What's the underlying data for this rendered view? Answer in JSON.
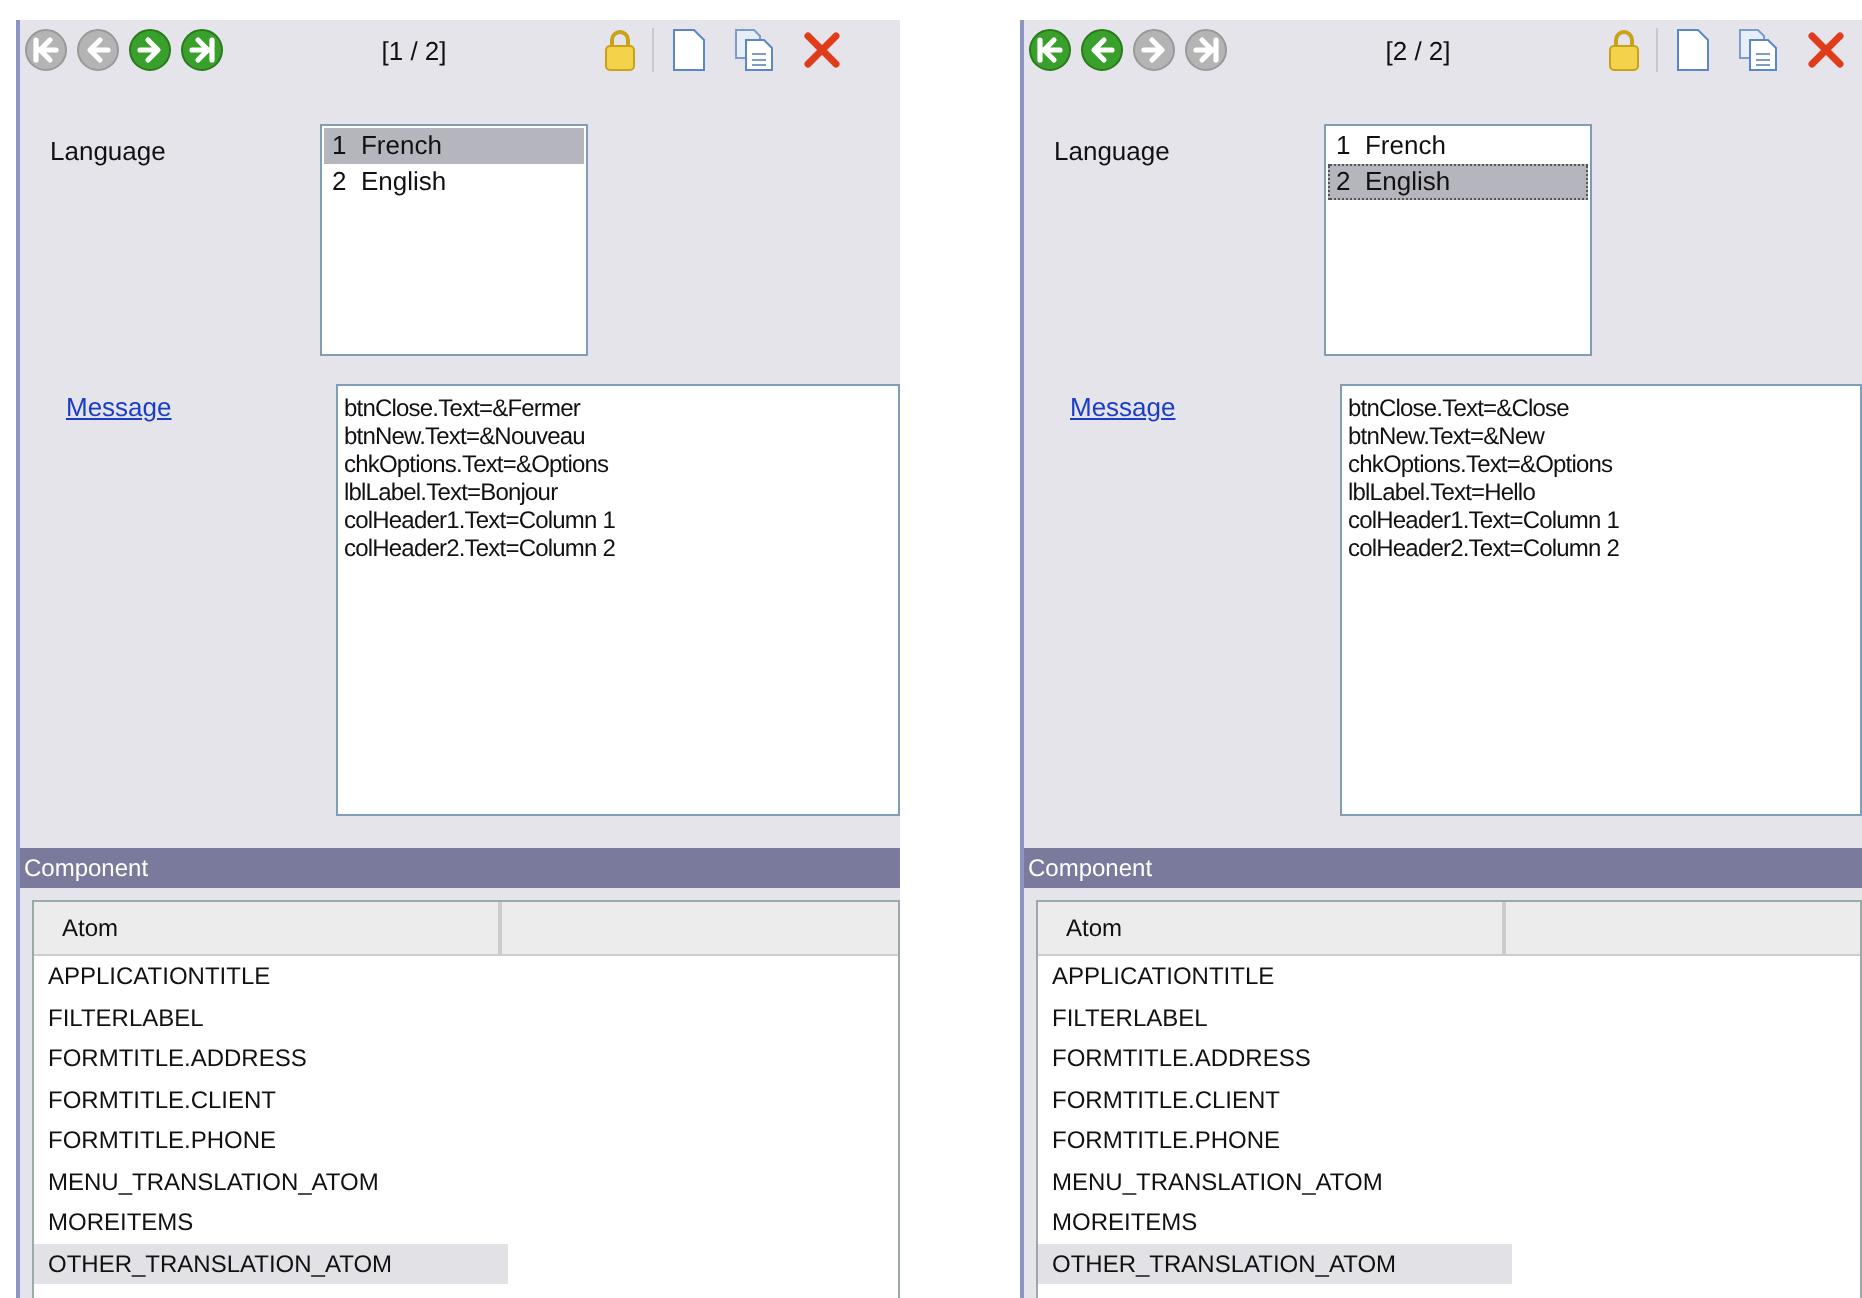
{
  "panels": [
    {
      "nav_buttons": [
        {
          "kind": "first",
          "disabled": true
        },
        {
          "kind": "previous",
          "disabled": true
        },
        {
          "kind": "next",
          "disabled": false
        },
        {
          "kind": "last",
          "disabled": false
        }
      ],
      "record_counter": "[1 / 2]",
      "language": {
        "label": "Language",
        "items": [
          {
            "number": "1",
            "name": "French",
            "selected": true
          },
          {
            "number": "2",
            "name": "English",
            "selected": false
          }
        ]
      },
      "message": {
        "label": "Message",
        "lines": [
          "btnClose.Text=&Fermer",
          "btnNew.Text=&Nouveau",
          "chkOptions.Text=&Options",
          "lblLabel.Text=Bonjour",
          "colHeader1.Text=Column 1",
          "colHeader2.Text=Column 2"
        ]
      },
      "component": {
        "title": "Component",
        "column": "Atom",
        "rows": [
          {
            "atom": "APPLICATIONTITLE",
            "selected": false
          },
          {
            "atom": "FILTERLABEL",
            "selected": false
          },
          {
            "atom": "FORMTITLE.ADDRESS",
            "selected": false
          },
          {
            "atom": "FORMTITLE.CLIENT",
            "selected": false
          },
          {
            "atom": "FORMTITLE.PHONE",
            "selected": false
          },
          {
            "atom": "MENU_TRANSLATION_ATOM",
            "selected": false
          },
          {
            "atom": "MOREITEMS",
            "selected": false
          },
          {
            "atom": "OTHER_TRANSLATION_ATOM",
            "selected": true
          }
        ]
      }
    },
    {
      "nav_buttons": [
        {
          "kind": "first",
          "disabled": false
        },
        {
          "kind": "previous",
          "disabled": false
        },
        {
          "kind": "next",
          "disabled": true
        },
        {
          "kind": "last",
          "disabled": true
        }
      ],
      "record_counter": "[2 / 2]",
      "language": {
        "label": "Language",
        "items": [
          {
            "number": "1",
            "name": "French",
            "selected": false
          },
          {
            "number": "2",
            "name": "English",
            "selected": true
          }
        ]
      },
      "message": {
        "label": "Message",
        "lines": [
          "btnClose.Text=&Close",
          "btnNew.Text=&New",
          "chkOptions.Text=&Options",
          "lblLabel.Text=Hello",
          "colHeader1.Text=Column 1",
          "colHeader2.Text=Column 2"
        ]
      },
      "component": {
        "title": "Component",
        "column": "Atom",
        "rows": [
          {
            "atom": "APPLICATIONTITLE",
            "selected": false
          },
          {
            "atom": "FILTERLABEL",
            "selected": false
          },
          {
            "atom": "FORMTITLE.ADDRESS",
            "selected": false
          },
          {
            "atom": "FORMTITLE.CLIENT",
            "selected": false
          },
          {
            "atom": "FORMTITLE.PHONE",
            "selected": false
          },
          {
            "atom": "MENU_TRANSLATION_ATOM",
            "selected": false
          },
          {
            "atom": "MOREITEMS",
            "selected": false
          },
          {
            "atom": "OTHER_TRANSLATION_ATOM",
            "selected": true
          }
        ]
      }
    }
  ]
}
